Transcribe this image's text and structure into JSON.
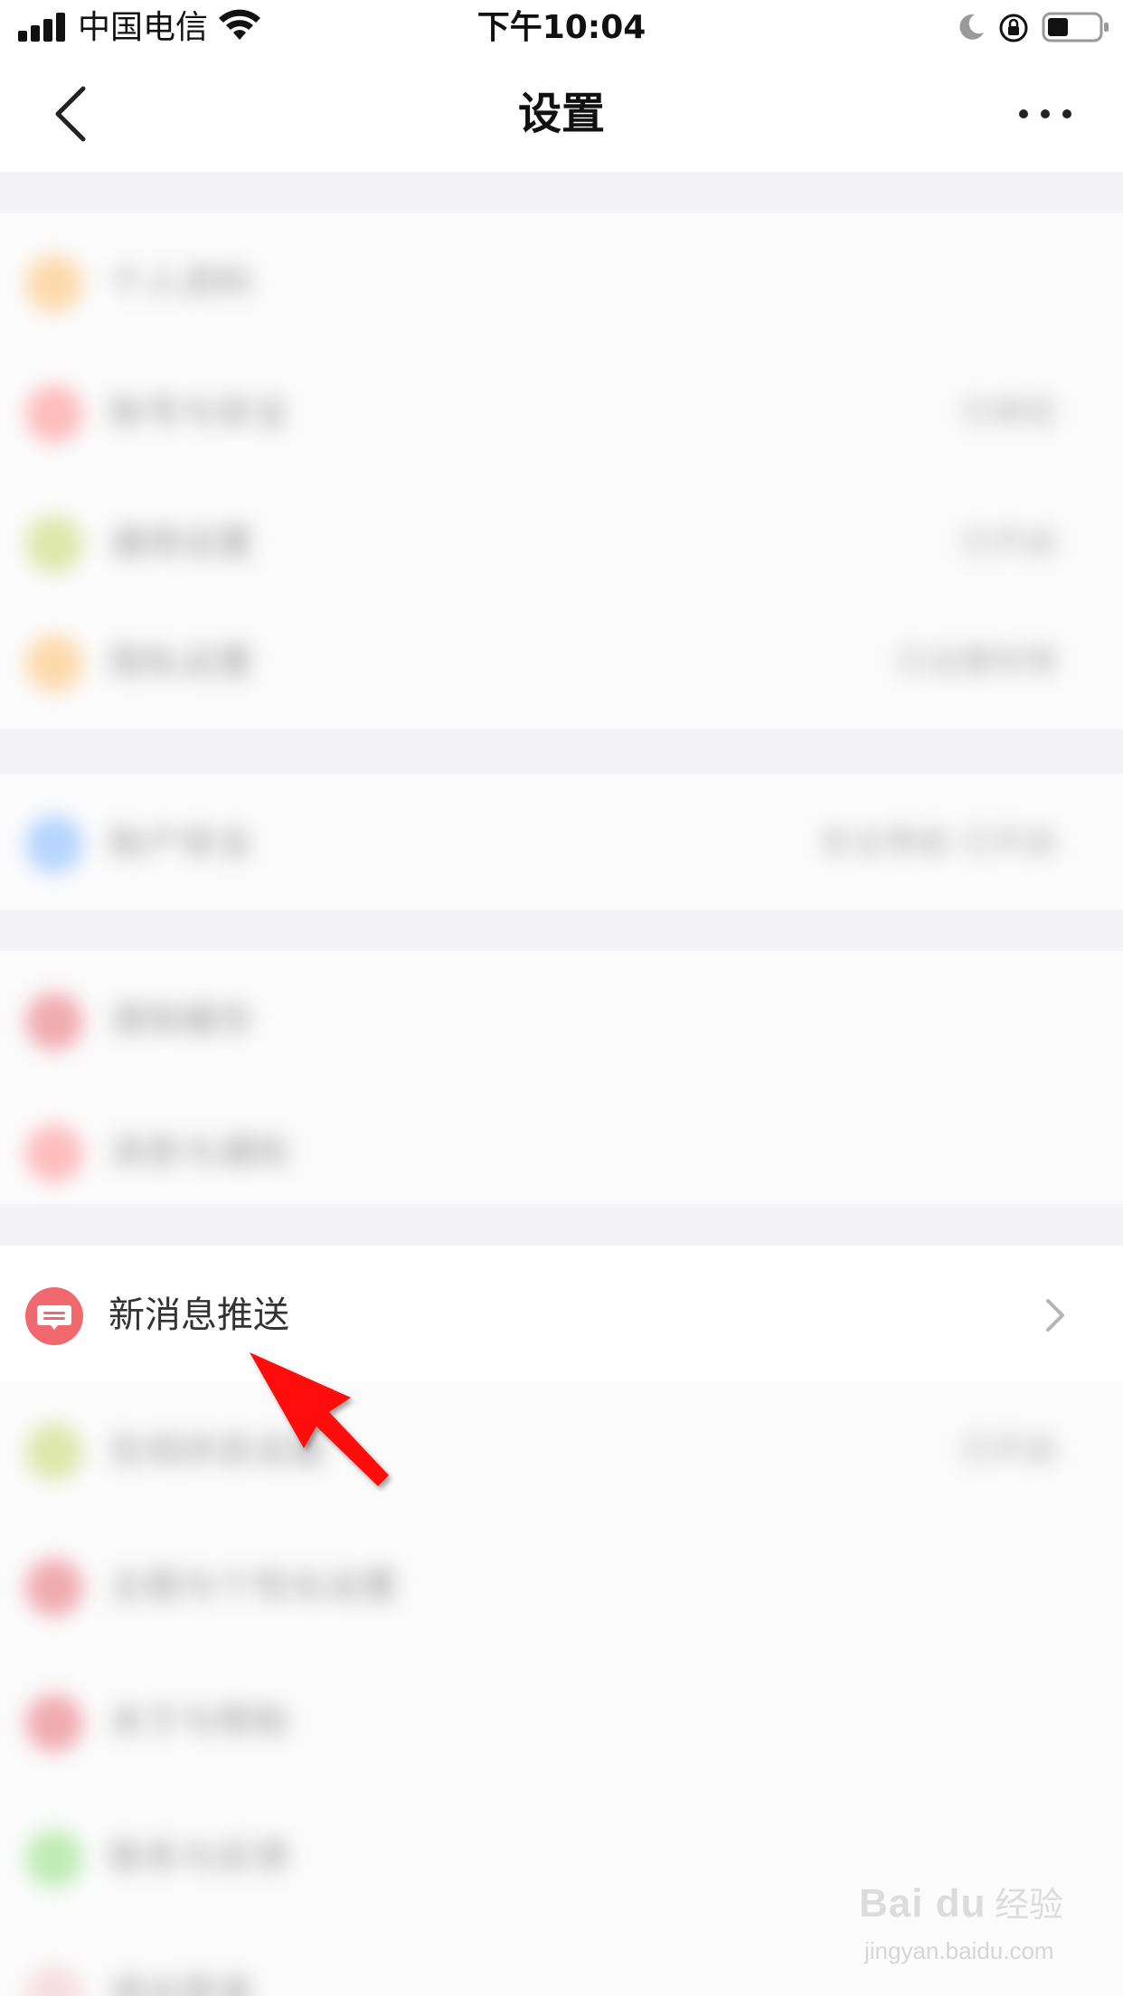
{
  "status_bar": {
    "carrier": "中国电信",
    "time": "下午10:04"
  },
  "nav": {
    "title": "设置"
  },
  "groups": [
    {
      "rows": [
        {
          "icon_color": "#ffbf6b",
          "label": "个人资料",
          "value": ""
        },
        {
          "icon_color": "#ff8a8a",
          "label": "账号与安全",
          "value": "已绑定"
        },
        {
          "icon_color": "#c7d76a",
          "label": "通用设置",
          "value": "已开启"
        },
        {
          "icon_color": "#ffbf6b",
          "label": "隐私设置",
          "value": "已设置权限"
        }
      ]
    },
    {
      "rows": [
        {
          "icon_color": "#7eb6ff",
          "label": "账户安全",
          "value": "安全等级 已开启"
        }
      ]
    },
    {
      "rows": [
        {
          "icon_color": "#e86a72",
          "label": "清除缓存",
          "value": ""
        },
        {
          "icon_color": "#ff8a8a",
          "label": "消息与通知",
          "value": ""
        }
      ]
    },
    {
      "rows": [
        {
          "icon_color": "#f0696e",
          "label": "新消息推送",
          "value": "",
          "active": true
        },
        {
          "icon_color": "#c7d76a",
          "label": "在线状态设置",
          "value": "已开启"
        },
        {
          "icon_color": "#e86a72",
          "label": "主题与个性化设置",
          "value": ""
        },
        {
          "icon_color": "#e86a72",
          "label": "关于与帮助",
          "value": ""
        },
        {
          "icon_color": "#8fe07a",
          "label": "联系与反馈",
          "value": ""
        },
        {
          "icon_color": "#f3c9c9",
          "label": "退出登录",
          "value": ""
        }
      ]
    }
  ],
  "annotation": {
    "arrow_color": "#ff1010"
  },
  "watermark": {
    "brand": "Bai du",
    "cn": "经验",
    "url": "jingyan.baidu.com"
  }
}
